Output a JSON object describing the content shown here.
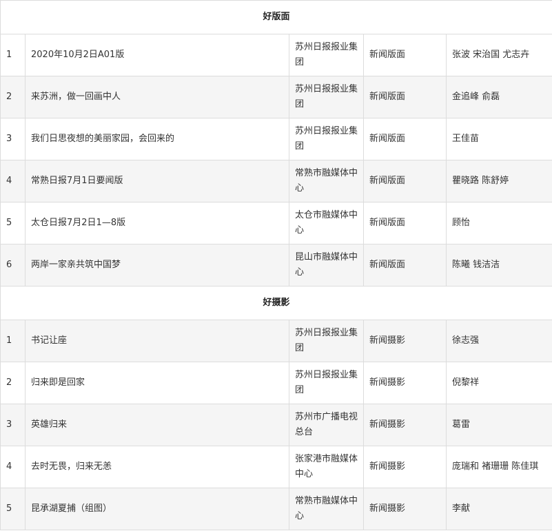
{
  "sections": [
    {
      "title": "好版面",
      "rows": [
        {
          "no": "1",
          "title": "2020年10月2日A01版",
          "org": "苏州日报报业集团",
          "category": "新闻版面",
          "authors": "张波 宋治国 尤志卉"
        },
        {
          "no": "2",
          "title": "来苏洲，做一回画中人",
          "org": "苏州日报报业集团",
          "category": "新闻版面",
          "authors": "金追峰 俞磊"
        },
        {
          "no": "3",
          "title": "我们日思夜想的美丽家园，会回来的",
          "org": "苏州日报报业集团",
          "category": "新闻版面",
          "authors": "王佳苗"
        },
        {
          "no": "4",
          "title": "常熟日报7月1日要闻版",
          "org": "常熟市融媒体中心",
          "category": "新闻版面",
          "authors": "瞿晓路 陈舒婷"
        },
        {
          "no": "5",
          "title": "太仓日报7月2日1—8版",
          "org": "太仓市融媒体中心",
          "category": "新闻版面",
          "authors": "顾怡"
        },
        {
          "no": "6",
          "title": "两岸一家亲共筑中国梦",
          "org": "昆山市融媒体中心",
          "category": "新闻版面",
          "authors": "陈曦 钱洁洁"
        }
      ]
    },
    {
      "title": "好摄影",
      "rows": [
        {
          "no": "1",
          "title": "书记让座",
          "org": "苏州日报报业集团",
          "category": "新闻摄影",
          "authors": "徐志强"
        },
        {
          "no": "2",
          "title": "归来即是回家",
          "org": "苏州日报报业集团",
          "category": "新闻摄影",
          "authors": "倪黎祥"
        },
        {
          "no": "3",
          "title": "英雄归来",
          "org": "苏州市广播电视总台",
          "category": "新闻摄影",
          "authors": "葛雷"
        },
        {
          "no": "4",
          "title": "去时无畏，归来无恙",
          "org": "张家港市融媒体中心",
          "category": "新闻摄影",
          "authors": "庞瑞和 褚珊珊 陈佳琪"
        },
        {
          "no": "5",
          "title": "昆承湖夏捕（组图）",
          "org": "常熟市融媒体中心",
          "category": "新闻摄影",
          "authors": "李献"
        }
      ]
    }
  ]
}
